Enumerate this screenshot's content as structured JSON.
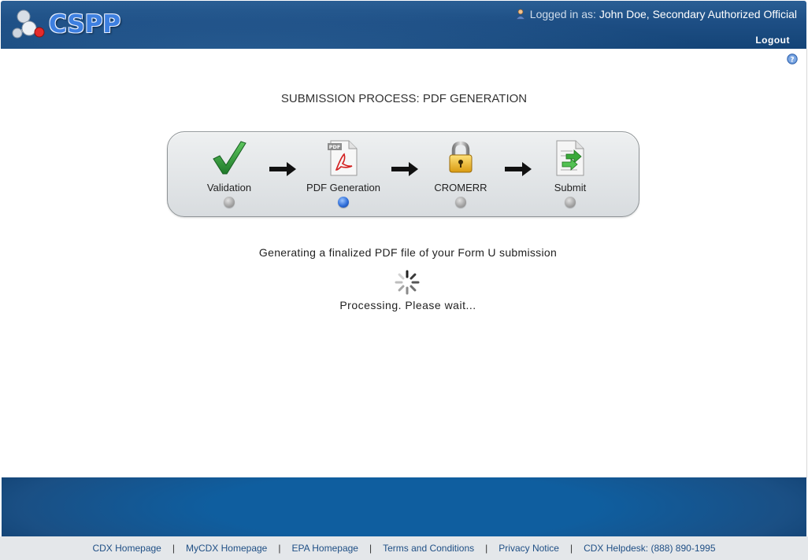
{
  "header": {
    "logo_text": "CSPP",
    "logged_in_label": "Logged in as:",
    "user_name": "John Doe, Secondary Authorized Official",
    "logout_label": "Logout"
  },
  "page": {
    "title": "SUBMISSION PROCESS: PDF GENERATION",
    "status_message": "Generating a finalized PDF file of your Form U submission",
    "processing_message": "Processing. Please wait..."
  },
  "steps": [
    {
      "label": "Validation",
      "icon": "checkmark-icon",
      "active": false
    },
    {
      "label": "PDF Generation",
      "icon": "pdf-file-icon",
      "active": true
    },
    {
      "label": "CROMERR",
      "icon": "padlock-icon",
      "active": false
    },
    {
      "label": "Submit",
      "icon": "submit-document-icon",
      "active": false
    }
  ],
  "footer": {
    "links": [
      "CDX Homepage",
      "MyCDX Homepage",
      "EPA Homepage",
      "Terms and Conditions",
      "Privacy Notice",
      "CDX Helpdesk: (888) 890-1995"
    ]
  },
  "colors": {
    "header_blue": "#1d4e84",
    "footer_blue": "#0f5e9f",
    "active_dot": "#2f6ed8",
    "link_color": "#1f4f85"
  }
}
